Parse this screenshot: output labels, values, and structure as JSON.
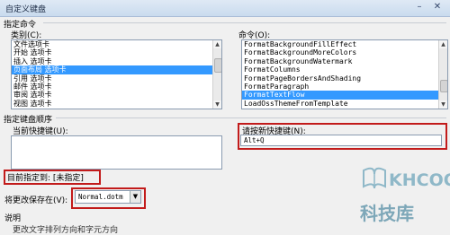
{
  "window": {
    "title": "自定义键盘"
  },
  "specify_command": {
    "group_label": "指定命令",
    "categories_label": "类别(C):",
    "categories": [
      {
        "label": "文件选项卡",
        "selected": false
      },
      {
        "label": "开始 选项卡",
        "selected": false
      },
      {
        "label": "插入 选项卡",
        "selected": false
      },
      {
        "label": "页面布局 选项卡",
        "selected": true
      },
      {
        "label": "引用 选项卡",
        "selected": false
      },
      {
        "label": "邮件 选项卡",
        "selected": false
      },
      {
        "label": "审阅 选项卡",
        "selected": false
      },
      {
        "label": "视图 选项卡",
        "selected": false
      }
    ],
    "commands_label": "命令(O):",
    "commands": [
      {
        "label": "FormatBackgroundFillEffect",
        "selected": false
      },
      {
        "label": "FormatBackgroundMoreColors",
        "selected": false
      },
      {
        "label": "FormatBackgroundWatermark",
        "selected": false
      },
      {
        "label": "FormatColumns",
        "selected": false
      },
      {
        "label": "FormatPageBordersAndShading",
        "selected": false
      },
      {
        "label": "FormatParagraph",
        "selected": false
      },
      {
        "label": "FormatTextFlow",
        "selected": true
      },
      {
        "label": "LoadOssThemeFromTemplate",
        "selected": false
      }
    ]
  },
  "keyboard_sequence": {
    "group_label": "指定键盘顺序",
    "current_keys_label": "当前快捷键(U):",
    "new_key_label": "请按新快捷键(N):",
    "new_key_value": "Alt+Q",
    "currently_assigned": "目前指定到: [未指定]"
  },
  "save_changes": {
    "label": "将更改保存在(V):",
    "selected": "Normal.dotm"
  },
  "description": {
    "label": "说明",
    "text_partial": "更改文字排列方向和字元方向"
  },
  "watermark": {
    "brand": "KHCOO",
    "cn": "科技库"
  },
  "icons": [
    "minimize-icon",
    "close-icon",
    "scroll-up-arrow-icon",
    "scroll-down-arrow-icon",
    "dropdown-arrow-icon",
    "book-logo-icon"
  ],
  "colors": {
    "selection": "#3399ff",
    "highlight_box": "#c21b1b"
  }
}
